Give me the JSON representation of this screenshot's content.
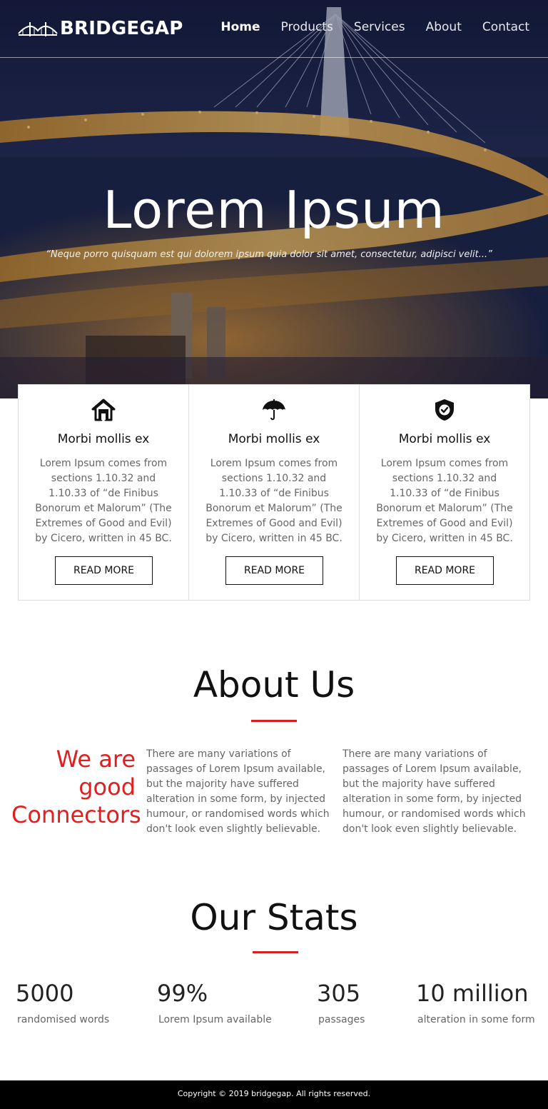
{
  "brand": {
    "name": "BRIDGEGAP",
    "logo_icon": "bridge-icon"
  },
  "nav": {
    "items": [
      {
        "label": "Home",
        "active": true
      },
      {
        "label": "Products",
        "active": false
      },
      {
        "label": "Services",
        "active": false
      },
      {
        "label": "About",
        "active": false
      },
      {
        "label": "Contact",
        "active": false
      }
    ]
  },
  "hero": {
    "title": "Lorem Ipsum",
    "quote": "“Neque porro quisquam est qui dolorem ipsum quia dolor sit amet, consectetur, adipisci velit...”"
  },
  "features": [
    {
      "icon": "home-icon",
      "title": "Morbi mollis ex",
      "text": "Lorem Ipsum comes from sections 1.10.32 and 1.10.33 of “de Finibus Bonorum et Malorum” (The Extremes of Good and Evil) by Cicero, written in 45 BC.",
      "button": "READ MORE"
    },
    {
      "icon": "umbrella-icon",
      "title": "Morbi mollis ex",
      "text": "Lorem Ipsum comes from sections 1.10.32 and 1.10.33 of “de Finibus Bonorum et Malorum” (The Extremes of Good and Evil) by Cicero, written in 45 BC.",
      "button": "READ MORE"
    },
    {
      "icon": "shield-check-icon",
      "title": "Morbi mollis ex",
      "text": "Lorem Ipsum comes from sections 1.10.32 and 1.10.33 of “de Finibus Bonorum et Malorum” (The Extremes of Good and Evil) by Cicero, written in 45 BC.",
      "button": "READ MORE"
    }
  ],
  "about": {
    "title": "About Us",
    "lead": "We are good Connectors",
    "columns": [
      "There are many variations of passages of Lorem Ipsum available, but the majority have suffered alteration in some form, by injected humour, or randomised words which don't look even slightly believable.",
      "There are many variations of passages of Lorem Ipsum available, but the majority have suffered alteration in some form, by injected humour, or randomised words which don't look even slightly believable."
    ]
  },
  "stats": {
    "title": "Our Stats",
    "items": [
      {
        "value": "5000",
        "label": "randomised words"
      },
      {
        "value": "99%",
        "label": "Lorem Ipsum available"
      },
      {
        "value": "305",
        "label": "passages"
      },
      {
        "value": "10 million",
        "label": "alteration in some form"
      }
    ]
  },
  "footer": {
    "text": "Copyright © 2019 bridgegap. All rights reserved."
  },
  "colors": {
    "accent": "#d61f1f",
    "lead_text": "#e02020",
    "footer_bg": "#000000"
  }
}
